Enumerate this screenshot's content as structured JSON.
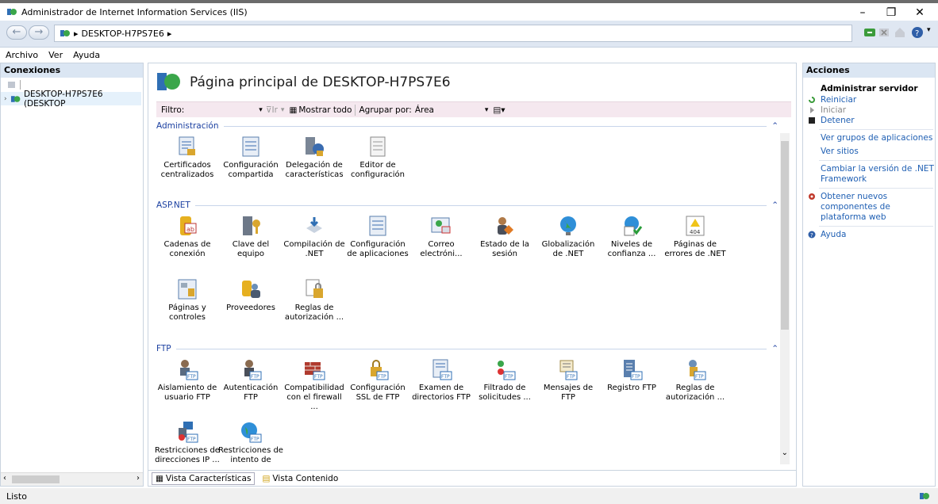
{
  "window": {
    "title": "Administrador de Internet Information Services (IIS)",
    "minimize": "–",
    "maximize": "❐",
    "close": "✕"
  },
  "address": {
    "back": "←",
    "forward": "→",
    "breadcrumb": [
      "DESKTOP-H7PS7E6"
    ]
  },
  "menu": [
    "Archivo",
    "Ver",
    "Ayuda"
  ],
  "connections": {
    "header": "Conexiones",
    "tree": [
      "DESKTOP-H7PS7E6 (DESKTOP"
    ]
  },
  "main": {
    "title": "Página principal de DESKTOP-H7PS7E6",
    "filter": {
      "label": "Filtro:",
      "go_label": "Ir",
      "show_all": "Mostrar todo",
      "group_by": "Agrupar por:",
      "group_value": "Área"
    },
    "groups": [
      {
        "name": "Administración",
        "items": [
          "Certificados centralizados",
          "Configuración compartida",
          "Delegación de características",
          "Editor de configuración"
        ]
      },
      {
        "name": "ASP.NET",
        "items": [
          "Cadenas de conexión",
          "Clave del equipo",
          "Compilación de .NET",
          "Configuración de aplicaciones",
          "Correo electróni...",
          "Estado de la sesión",
          "Globalización de .NET",
          "Niveles de confianza ...",
          "Páginas de errores de .NET",
          "Páginas y controles",
          "Proveedores",
          "Reglas de autorización ..."
        ]
      },
      {
        "name": "FTP",
        "items": [
          "Aislamiento de usuario FTP",
          "Autenticación FTP",
          "Compatibilidad con el firewall ...",
          "Configuración SSL de FTP",
          "Examen de directorios FTP",
          "Filtrado de solicitudes ...",
          "Mensajes de FTP",
          "Registro FTP",
          "Reglas de autorización ...",
          "Restricciones de direcciones IP ...",
          "Restricciones de intento de inici..."
        ]
      }
    ],
    "tabs": [
      "Vista Características",
      "Vista Contenido"
    ]
  },
  "actions": {
    "header": "Acciones",
    "section": "Administrar servidor",
    "items": [
      {
        "label": "Reiniciar",
        "enabled": true
      },
      {
        "label": "Iniciar",
        "enabled": false
      },
      {
        "label": "Detener",
        "enabled": true
      },
      {
        "label": "Ver grupos de aplicaciones",
        "enabled": true
      },
      {
        "label": "Ver sitios",
        "enabled": true
      },
      {
        "label": "Cambiar la versión de .NET Framework",
        "enabled": true
      },
      {
        "label": "Obtener nuevos componentes de plataforma web",
        "enabled": true
      },
      {
        "label": "Ayuda",
        "enabled": true
      }
    ]
  },
  "status": {
    "text": "Listo"
  },
  "colors": {
    "link": "#1f5fb3",
    "group_header": "#1a3fa0",
    "pane_header": "#dbe6f3",
    "filter_bg": "#f5e8ef"
  }
}
